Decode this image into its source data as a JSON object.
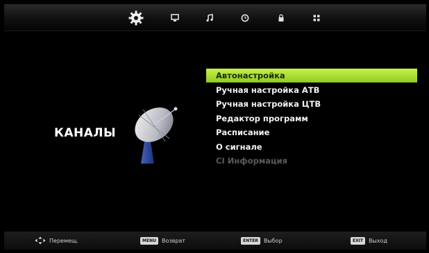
{
  "topbar": {
    "tabs": [
      {
        "name": "gear-icon",
        "active": true
      },
      {
        "name": "tv-icon"
      },
      {
        "name": "music-note-icon"
      },
      {
        "name": "clock-icon"
      },
      {
        "name": "lock-icon"
      },
      {
        "name": "grid-icon"
      }
    ]
  },
  "section": {
    "title": "КАНАЛЫ"
  },
  "menu": {
    "items": [
      {
        "label": "Автонастройка",
        "state": "selected"
      },
      {
        "label": "Ручная настройка АТВ",
        "state": "normal"
      },
      {
        "label": "Ручная настройка ЦТВ",
        "state": "normal"
      },
      {
        "label": "Редактор программ",
        "state": "normal"
      },
      {
        "label": "Расписание",
        "state": "normal"
      },
      {
        "label": "О сигнале",
        "state": "normal"
      },
      {
        "label": "CI Информация",
        "state": "disabled"
      }
    ]
  },
  "hints": {
    "move": {
      "label": "Перемещ."
    },
    "back": {
      "key": "MENU",
      "label": "Возврат"
    },
    "select": {
      "key": "ENTER",
      "label": "Выбор"
    },
    "exit": {
      "key": "EXIT",
      "label": "Выход"
    }
  },
  "colors": {
    "highlight": "#a8e032",
    "background": "#000000",
    "text": "#f2f2f2",
    "disabled_text": "#5a5a5a"
  }
}
